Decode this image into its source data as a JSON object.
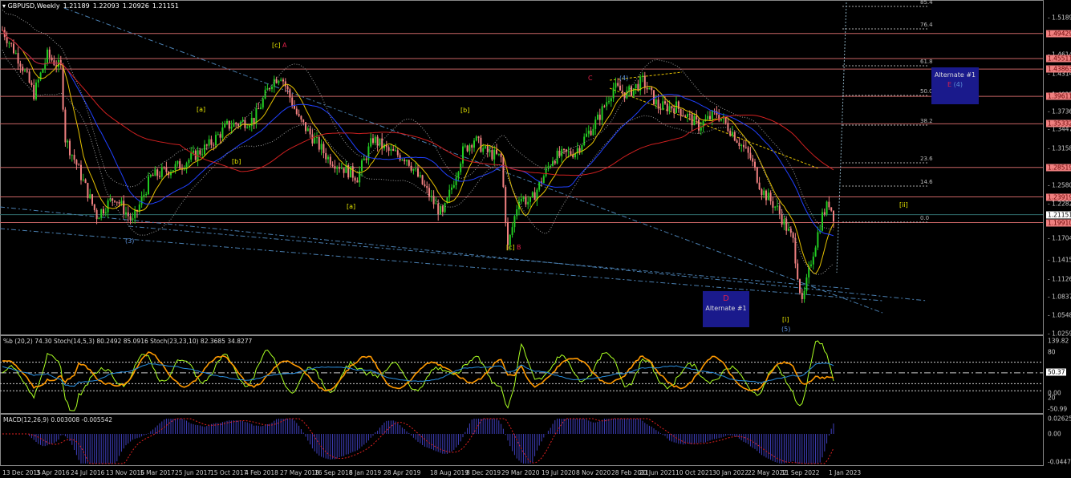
{
  "header": {
    "symbol": "GBPUSD,Weekly",
    "open": "1.21189",
    "high": "1.22093",
    "low": "1.20926",
    "close": "1.21151"
  },
  "price_axis": {
    "ticks": [
      [
        "1.51895",
        22
      ],
      [
        "1.46145",
        68
      ],
      [
        "1.43140",
        92
      ],
      [
        "1.40250",
        118
      ],
      [
        "1.37360",
        139
      ],
      [
        "1.34470",
        161
      ],
      [
        "1.31580",
        185
      ],
      [
        "1.25800",
        231
      ],
      [
        "1.22825",
        254
      ],
      [
        "1.17045",
        297
      ],
      [
        "1.14155",
        324
      ],
      [
        "1.11265",
        348
      ],
      [
        "1.08375",
        370
      ],
      [
        "1.05485",
        393
      ],
      [
        "1.02595",
        416
      ]
    ],
    "levels": [
      "1.49429",
      "1.45511",
      "1.43863",
      "1.39611",
      "1.35332",
      "1.28519",
      "1.23919",
      "1.19910"
    ],
    "current": "1.21151"
  },
  "dates": [
    "13 Dec 2015",
    "3 Apr 2016",
    "24 Jul 2016",
    "13 Nov 2016",
    "5 Mar 2017",
    "25 Jun 2017",
    "15 Oct 2017",
    "4 Feb 2018",
    "27 May 2018",
    "16 Sep 2018",
    "6 Jan 2019",
    "28 Apr 2019",
    "18 Aug 2019",
    "8 Dec 2019",
    "29 Mar 2020",
    "19 Jul 2020",
    "8 Nov 2020",
    "28 Feb 2021",
    "20 Jun 2021",
    "10 Oct 2021",
    "30 Jan 2022",
    "22 May 2022",
    "11 Sep 2022",
    "1 Jan 2023"
  ],
  "fib_levels": [
    "85.4",
    "76.4",
    "61.8",
    "50.0",
    "38.2",
    "23.6",
    "14.6",
    "0.0"
  ],
  "waves": {
    "c1": "[c]",
    "A1": "A",
    "a1": "[a]",
    "b1": "[b]",
    "w3": "(3)",
    "a2": "[a]",
    "b2": "[b]",
    "c2": "[c]",
    "B": "B",
    "C": "C",
    "w4": "(4)",
    "i": "[i]",
    "w5": "(5)",
    "ii": "[ii]"
  },
  "boxes": {
    "d_label": "D",
    "d_alt": "Alternate #1",
    "e_alt": "Alternate #1",
    "e_label": "E",
    "e_wave": "(4)"
  },
  "oscillator": {
    "label": "%b (20,2) 74.30  Stoch(14,5,3) 80.2492 85.0916  Stoch(23,23,10) 82.3685 34.8277",
    "ticks": [
      "139.82",
      "80",
      "50.37",
      "0.00",
      "20",
      "-50.99"
    ]
  },
  "macd": {
    "label": "MACD(12,26,9) 0.003008 -0.005542",
    "ticks": [
      "0.026251",
      "0.00",
      "-0.044743"
    ]
  },
  "chart_data": {
    "type": "candlestick",
    "symbol": "GBPUSD",
    "timeframe": "Weekly",
    "ylim": [
      1.02595,
      1.51895
    ],
    "price_path_week_price": [
      [
        0,
        1.5
      ],
      [
        8,
        1.45
      ],
      [
        14,
        1.4
      ],
      [
        20,
        1.46
      ],
      [
        26,
        1.44
      ],
      [
        28,
        1.33
      ],
      [
        33,
        1.29
      ],
      [
        42,
        1.21
      ],
      [
        50,
        1.24
      ],
      [
        58,
        1.2
      ],
      [
        66,
        1.27
      ],
      [
        80,
        1.29
      ],
      [
        92,
        1.32
      ],
      [
        100,
        1.35
      ],
      [
        112,
        1.36
      ],
      [
        120,
        1.42
      ],
      [
        124,
        1.43
      ],
      [
        132,
        1.36
      ],
      [
        145,
        1.3
      ],
      [
        158,
        1.27
      ],
      [
        165,
        1.33
      ],
      [
        172,
        1.31
      ],
      [
        180,
        1.3
      ],
      [
        192,
        1.23
      ],
      [
        196,
        1.21
      ],
      [
        205,
        1.31
      ],
      [
        210,
        1.33
      ],
      [
        215,
        1.31
      ],
      [
        222,
        1.3
      ],
      [
        225,
        1.16
      ],
      [
        230,
        1.24
      ],
      [
        235,
        1.23
      ],
      [
        245,
        1.3
      ],
      [
        255,
        1.31
      ],
      [
        265,
        1.36
      ],
      [
        272,
        1.41
      ],
      [
        278,
        1.4
      ],
      [
        285,
        1.42
      ],
      [
        292,
        1.38
      ],
      [
        300,
        1.38
      ],
      [
        310,
        1.35
      ],
      [
        318,
        1.37
      ],
      [
        325,
        1.34
      ],
      [
        333,
        1.3
      ],
      [
        338,
        1.25
      ],
      [
        345,
        1.22
      ],
      [
        352,
        1.17
      ],
      [
        356,
        1.07
      ],
      [
        360,
        1.14
      ],
      [
        365,
        1.21
      ],
      [
        368,
        1.23
      ],
      [
        370,
        1.21
      ]
    ]
  }
}
